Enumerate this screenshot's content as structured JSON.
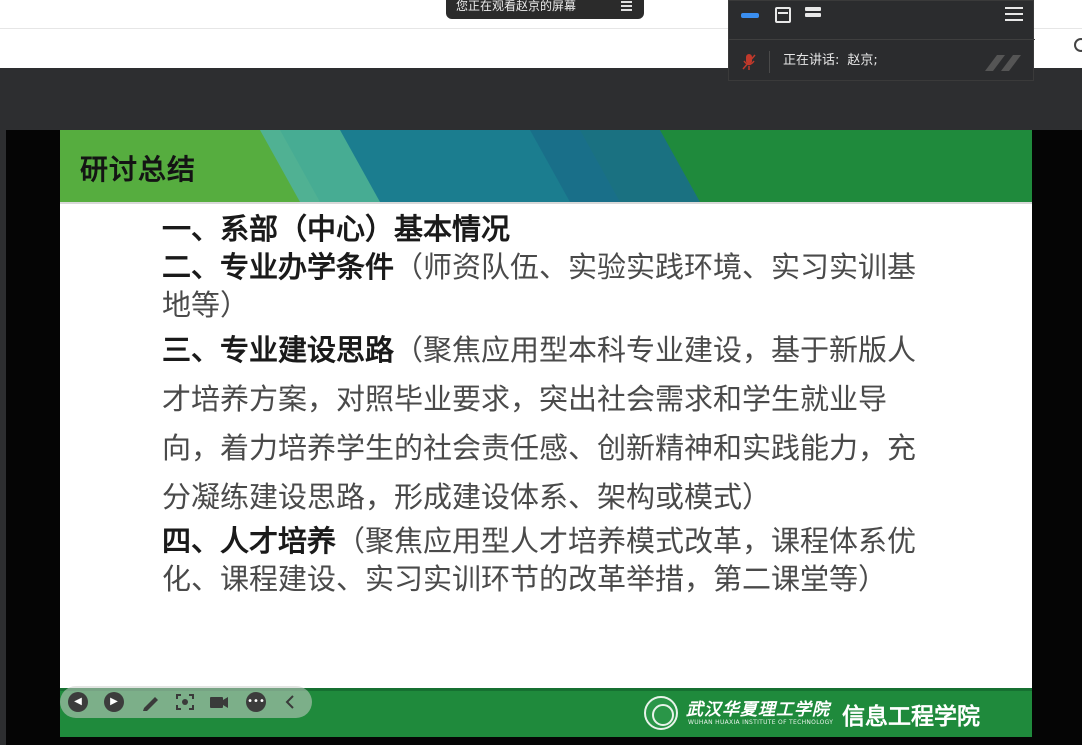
{
  "share_banner": {
    "text": "您正在观看赵京的屏幕",
    "menu_icon": "menu-icon"
  },
  "meeting_panel": {
    "speaking_label": "正在讲话:",
    "speaker_name": "赵京;",
    "active_view": "speaker",
    "icons": [
      "speaker-view-icon",
      "gallery-view-icon",
      "list-view-icon",
      "collapse-panel-icon",
      "mic-muted-icon"
    ]
  },
  "slide": {
    "title": "研讨总结",
    "items": [
      {
        "lead": "一、系部（中心）基本情况",
        "rest": ""
      },
      {
        "lead": "二、专业办学条件",
        "rest": "（师资队伍、实验实践环境、实习实训基地等）"
      },
      {
        "lead": "三、专业建设思路",
        "rest": "（聚焦应用型本科专业建设，基于新版人才培养方案，对照毕业要求，突出社会需求和学生就业导向，着力培养学生的社会责任感、创新精神和实践能力，充分凝练建设思路，形成建设体系、架构或模式）"
      },
      {
        "lead": "四、人才培养",
        "rest": "（聚焦应用型人才培养模式改革，课程体系优化、课程建设、实习实训环节的改革举措，第二课堂等）"
      }
    ],
    "footer": {
      "school_name": "武汉华夏理工学院",
      "school_name_en": "WUHAN HUAXIA INSTITUTE OF TECHNOLOGY",
      "department": "信息工程学院"
    },
    "colors": {
      "header_green": "#1f8a3c",
      "header_teal": "#1b7d8f",
      "footer_green": "#1f8a3c"
    }
  },
  "presentation_toolbar": {
    "buttons": [
      "previous-slide-icon",
      "next-slide-icon",
      "pen-icon",
      "screenshot-icon",
      "camera-icon",
      "more-icon",
      "collapse-toolbar-icon"
    ]
  }
}
